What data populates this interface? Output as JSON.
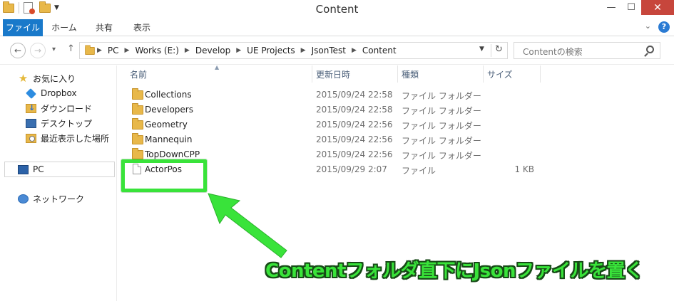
{
  "window": {
    "title": "Content"
  },
  "ribbon": {
    "tabs": [
      "ファイル",
      "ホーム",
      "共有",
      "表示"
    ]
  },
  "address": {
    "crumbs": [
      "PC",
      "Works (E:)",
      "Develop",
      "UE Projects",
      "JsonTest",
      "Content"
    ]
  },
  "search": {
    "placeholder": "Contentの検索"
  },
  "nav": {
    "favorites_label": "お気に入り",
    "items": [
      "Dropbox",
      "ダウンロード",
      "デスクトップ",
      "最近表示した場所"
    ],
    "pc_label": "PC",
    "network_label": "ネットワーク"
  },
  "columns": {
    "name": "名前",
    "date": "更新日時",
    "type": "種類",
    "size": "サイズ"
  },
  "files": [
    {
      "name": "Collections",
      "date": "2015/09/24 22:58",
      "type": "ファイル フォルダー",
      "size": "",
      "icon": "folder-icon"
    },
    {
      "name": "Developers",
      "date": "2015/09/24 22:58",
      "type": "ファイル フォルダー",
      "size": "",
      "icon": "folder-icon"
    },
    {
      "name": "Geometry",
      "date": "2015/09/24 22:56",
      "type": "ファイル フォルダー",
      "size": "",
      "icon": "folder-icon"
    },
    {
      "name": "Mannequin",
      "date": "2015/09/24 22:56",
      "type": "ファイル フォルダー",
      "size": "",
      "icon": "folder-icon"
    },
    {
      "name": "TopDownCPP",
      "date": "2015/09/24 22:56",
      "type": "ファイル フォルダー",
      "size": "",
      "icon": "folder-icon"
    },
    {
      "name": "ActorPos",
      "date": "2015/09/29 2:07",
      "type": "ファイル",
      "size": "1 KB",
      "icon": "file-icon"
    }
  ],
  "annotation": {
    "text": "Contentフォルダ直下にJsonファイルを置く",
    "color": "#39e33a"
  },
  "colors": {
    "file_tab": "#1979ca",
    "close_button": "#c7463c",
    "highlight": "#39e33a"
  }
}
